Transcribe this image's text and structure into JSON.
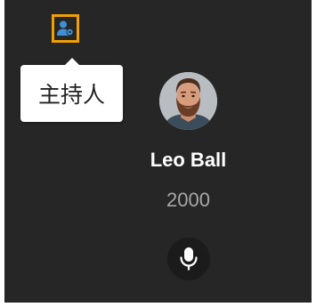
{
  "host_badge": {
    "icon": "host-user-icon",
    "tooltip": "主持人",
    "border_color": "#f0a000",
    "icon_color": "#3f8fd6"
  },
  "participant": {
    "name": "Leo Ball",
    "score": "2000",
    "avatar_icon": "bearded-man-avatar"
  },
  "controls": {
    "mic_icon": "microphone-icon"
  },
  "colors": {
    "tile_background": "#262626",
    "score_text": "#a7a7a7"
  }
}
